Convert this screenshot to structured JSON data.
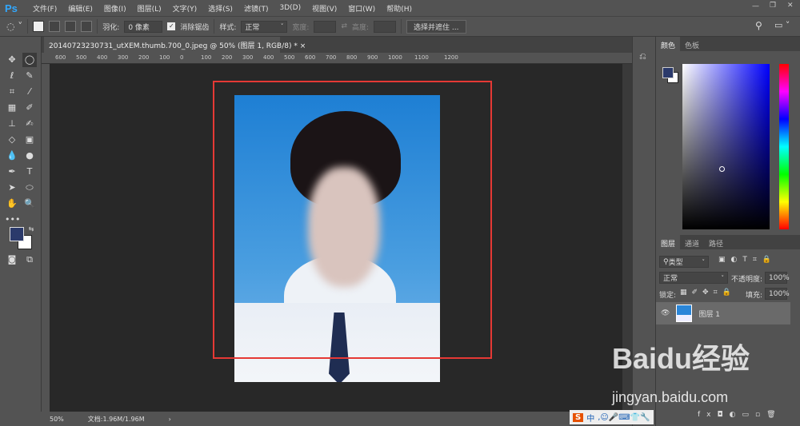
{
  "app": {
    "logo": "Ps"
  },
  "menu": [
    "文件(F)",
    "编辑(E)",
    "图像(I)",
    "图层(L)",
    "文字(Y)",
    "选择(S)",
    "滤镜(T)",
    "3D(D)",
    "视图(V)",
    "窗口(W)",
    "帮助(H)"
  ],
  "options": {
    "feather_label": "羽化:",
    "feather_value": "0 像素",
    "antialias_label": "消除锯齿",
    "antialias_checked": true,
    "style_label": "样式:",
    "style_value": "正常",
    "width_label": "宽度:",
    "height_label": "高度:",
    "select_mask_button": "选择并遮住 ..."
  },
  "document": {
    "tab_title": "20140723230731_utXEM.thumb.700_0.jpeg @ 50% (图层 1, RGB/8) *",
    "close": "×"
  },
  "ruler": {
    "top": [
      "600",
      "500",
      "400",
      "300",
      "200",
      "100",
      "0",
      "100",
      "200",
      "300",
      "400",
      "500",
      "600",
      "700",
      "800",
      "900",
      "1000",
      "1100",
      "1200"
    ]
  },
  "status": {
    "zoom": "50%",
    "doc": "文档:1.96M/1.96M",
    "arrow": "›"
  },
  "color_panel": {
    "tabs": [
      "颜色",
      "色板"
    ],
    "foreground": "#2b3a6b",
    "background": "#ffffff"
  },
  "layers_panel": {
    "tabs": [
      "图层",
      "通道",
      "路径"
    ],
    "filter": "类型",
    "blend_mode": "正常",
    "opacity_label": "不透明度:",
    "opacity": "100%",
    "lock_label": "锁定:",
    "fill_label": "填充:",
    "fill": "100%",
    "layers": [
      {
        "name": "图层 1",
        "visible": true
      }
    ],
    "footer_fx": "fx"
  },
  "watermark": {
    "brand": "Baidu经验",
    "url": "jingyan.baidu.com"
  },
  "ime": {
    "lang": "中"
  }
}
